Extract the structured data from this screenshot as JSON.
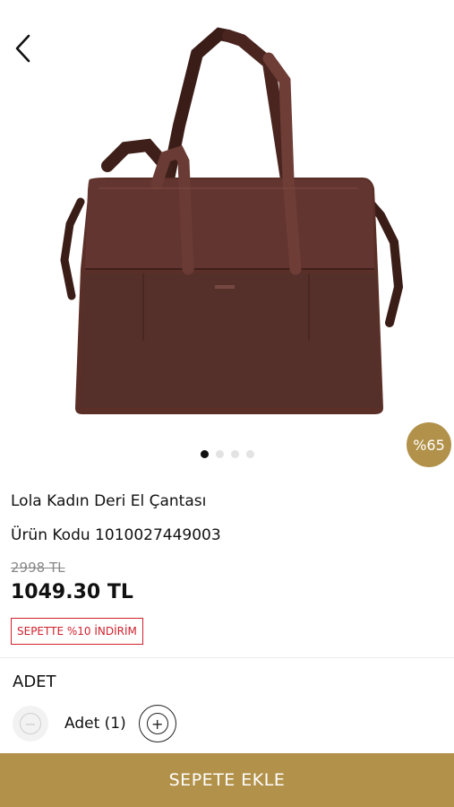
{
  "product": {
    "name": "Lola Kadın Deri El Çantası",
    "code_text": "Ürün Kodu 1010027449003",
    "old_price": "2998 TL",
    "price": "1049.30 TL",
    "discount_badge": "%65",
    "promo_text": "SEPETTE %10 İNDİRİM",
    "image_index": 1,
    "image_count": 4
  },
  "quantity": {
    "title": "ADET",
    "label": "Adet (1)",
    "value": 1
  },
  "cta": {
    "add_to_cart": "SEPETE EKLE"
  },
  "colors": {
    "accent": "#b2924a",
    "promo_red": "#d0222d",
    "bag_brown": "#5a2f27"
  }
}
